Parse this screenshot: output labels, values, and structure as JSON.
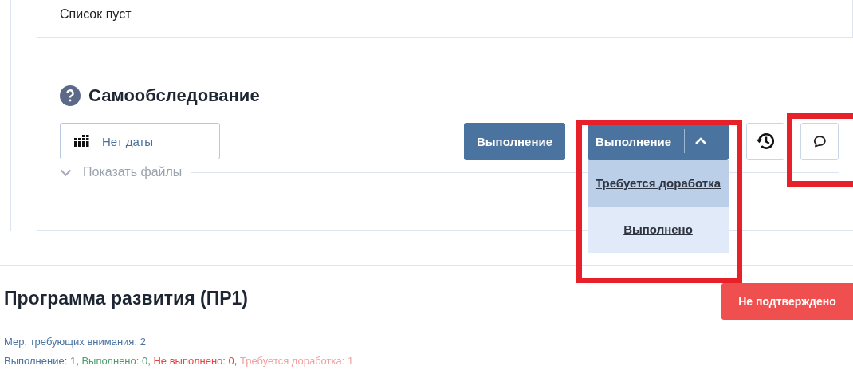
{
  "empty_list": {
    "text": "Список пуст"
  },
  "section": {
    "title": "Самообследование",
    "date_field": {
      "placeholder": "Нет даты"
    },
    "status_button": "Выполнение",
    "status_dropdown": {
      "label": "Выполнение",
      "expanded": true,
      "options": [
        {
          "label": "Требуется доработка",
          "selected": true
        },
        {
          "label": "Выполнено",
          "selected": false
        }
      ]
    },
    "files_toggle": {
      "label": "Показать файлы",
      "expanded": false
    }
  },
  "program": {
    "title": "Программа развития (ПР1)",
    "badge": "Не подтверждено",
    "attention": "Мер, требующих внимания: 2",
    "separator": ",",
    "counts": [
      {
        "text": "Выполнение: 1",
        "color": "#4a73a0"
      },
      {
        "text": "Выполнено: 0",
        "color": "#4c9e6c"
      },
      {
        "text": "Не выполнено: 0",
        "color": "#ea4343"
      },
      {
        "text": "Требуется доработка: 1",
        "color": "#f2a0a0"
      }
    ]
  }
}
